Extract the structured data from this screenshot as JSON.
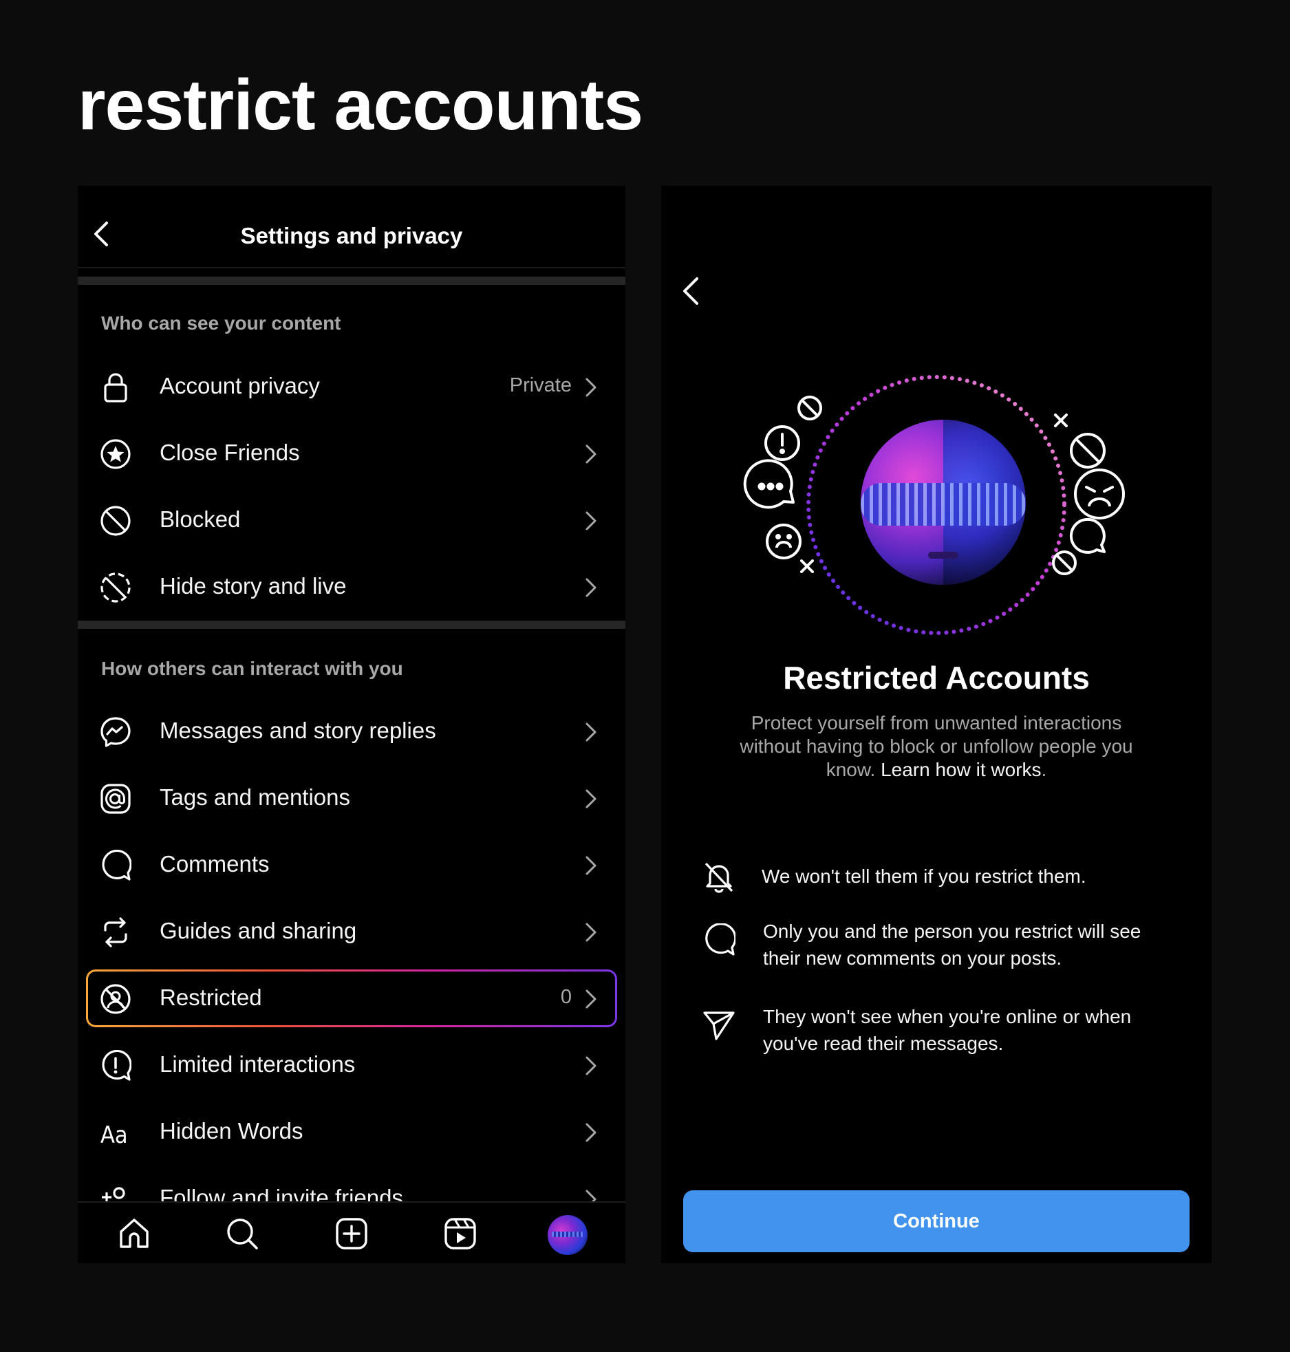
{
  "heading": "restrict accounts",
  "settings": {
    "title": "Settings and privacy",
    "section1_header": "Who can see your content",
    "section2_header": "How others can interact with you",
    "rows": [
      {
        "label": "Account privacy",
        "value": "Private",
        "icon": "lock-icon"
      },
      {
        "label": "Close Friends",
        "value": "",
        "icon": "star-circle-icon"
      },
      {
        "label": "Blocked",
        "value": "",
        "icon": "block-icon"
      },
      {
        "label": "Hide story and live",
        "value": "",
        "icon": "hide-story-icon"
      },
      {
        "label": "Messages and story replies",
        "value": "",
        "icon": "messenger-icon"
      },
      {
        "label": "Tags and mentions",
        "value": "",
        "icon": "at-sign-icon"
      },
      {
        "label": "Comments",
        "value": "",
        "icon": "comment-icon"
      },
      {
        "label": "Guides and sharing",
        "value": "",
        "icon": "share-cycle-icon"
      },
      {
        "label": "Restricted",
        "value": "0",
        "icon": "restricted-icon"
      },
      {
        "label": "Limited interactions",
        "value": "",
        "icon": "limited-interactions-icon"
      },
      {
        "label": "Hidden Words",
        "value": "",
        "icon": "hidden-words-icon"
      },
      {
        "label": "Follow and invite friends",
        "value": "",
        "icon": "add-person-icon"
      }
    ],
    "hidden_words_glyph": "Aa",
    "highlight_gradient": [
      "#f9a937",
      "#f0523b",
      "#d6249f",
      "#7a35e9"
    ]
  },
  "navbar": {
    "items": [
      "home-icon",
      "search-icon",
      "create-icon",
      "reels-icon",
      "profile-avatar"
    ]
  },
  "restricted": {
    "title": "Restricted Accounts",
    "description_main": "Protect yourself from unwanted interactions without having to block or unfollow people you know.",
    "description_link": "Learn how it works",
    "description_end": ".",
    "features": [
      {
        "icon": "bell-off-icon",
        "text": "We won't tell them if you restrict them."
      },
      {
        "icon": "comment-icon",
        "text": "Only you and the person you restrict will see their new comments on your posts."
      },
      {
        "icon": "paper-plane-icon",
        "text": "They won't see when you're online or when you've read their messages."
      }
    ],
    "continue_label": "Continue",
    "accent_color": "#4193ed"
  }
}
